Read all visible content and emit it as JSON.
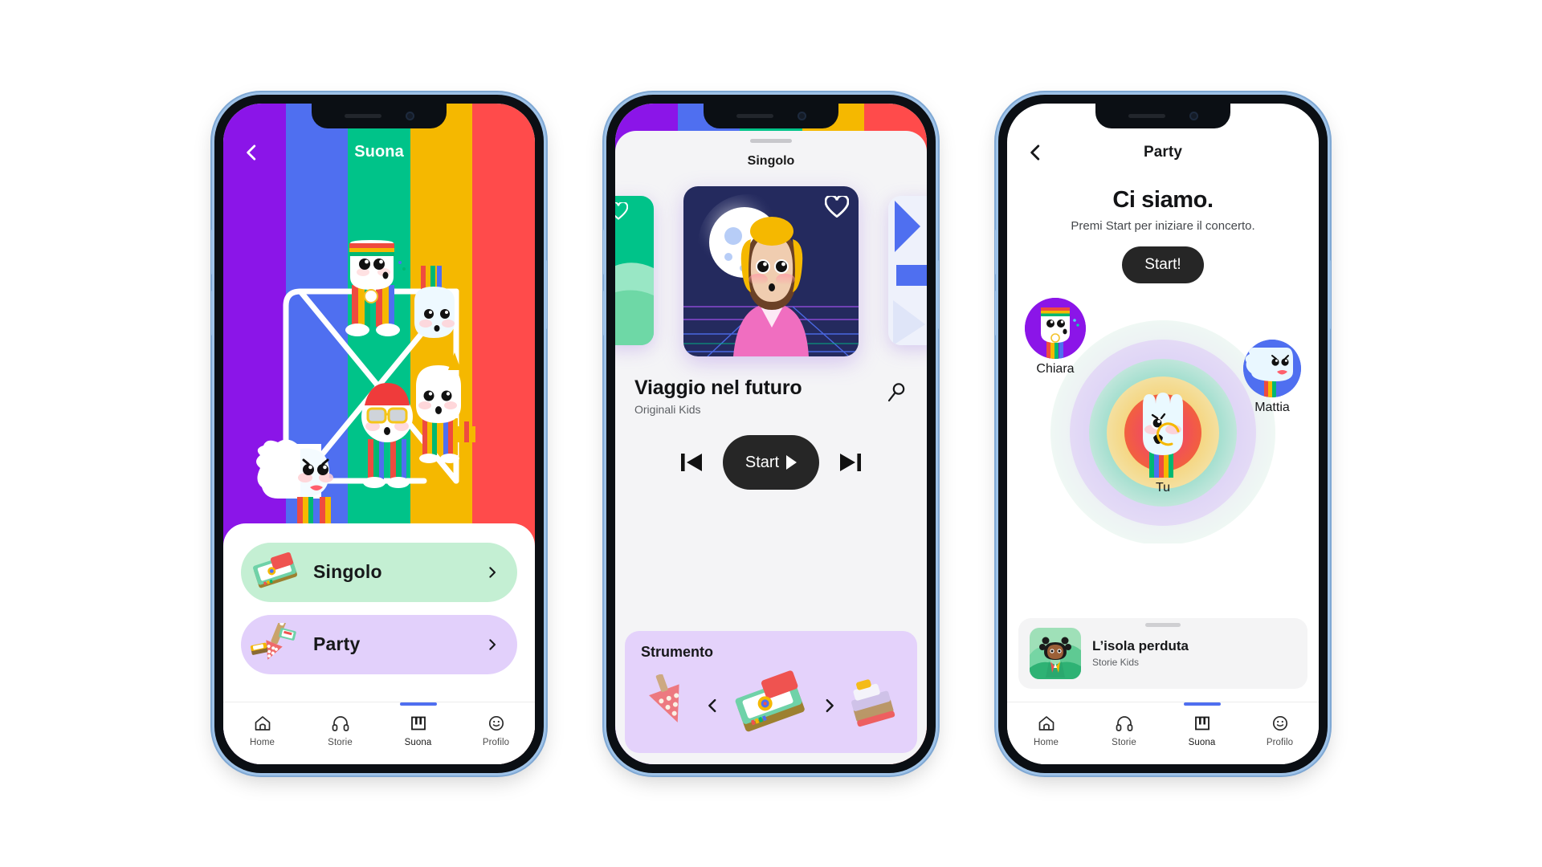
{
  "palette": {
    "purple": "#8B15E8",
    "blue": "#4F6FF0",
    "green": "#00C389",
    "yellow": "#F5B800",
    "red": "#FF4B4B",
    "accent_tab": "#4f6ff0",
    "dark_button": "#262626",
    "mint_row": "#C4EFD3",
    "lavender_row": "#E2D0FB",
    "instrument_panel": "#E4D2FB"
  },
  "tabbar": {
    "items": [
      {
        "label": "Home",
        "icon": "home-icon",
        "active": false
      },
      {
        "label": "Storie",
        "icon": "headphones-icon",
        "active": false
      },
      {
        "label": "Suona",
        "icon": "piano-keys-icon",
        "active": true
      },
      {
        "label": "Profilo",
        "icon": "smiley-face-icon",
        "active": false
      }
    ]
  },
  "phone1": {
    "header": {
      "title": "Suona",
      "back_icon": "chevron-left-icon"
    },
    "menu": [
      {
        "label": "Singolo",
        "icon": "keyboard-instrument-icon",
        "chevron": "chevron-right-icon"
      },
      {
        "label": "Party",
        "icon": "instruments-group-icon",
        "chevron": "chevron-right-icon"
      }
    ]
  },
  "phone2": {
    "header": {
      "title": "Singolo"
    },
    "album": {
      "favorite_icon": "heart-outline-icon"
    },
    "song": {
      "title": "Viaggio nel futuro",
      "artist": "Originali Kids"
    },
    "search_icon": "search-icon",
    "controls": {
      "previous_icon": "skip-previous-icon",
      "start_label": "Start",
      "play_icon": "play-triangle-icon",
      "next_icon": "skip-next-icon"
    },
    "instrument": {
      "title": "Strumento",
      "prev_icon": "chevron-left-icon",
      "next_icon": "chevron-right-icon"
    }
  },
  "phone3": {
    "header": {
      "title": "Party",
      "back_icon": "chevron-left-icon"
    },
    "hero": {
      "heading": "Ci siamo.",
      "subtitle": "Premi Start per iniziare il concerto.",
      "button_label": "Start!"
    },
    "peers": [
      {
        "name": "Chiara",
        "ring_color": "#8B15E8"
      },
      {
        "name": "Mattia",
        "ring_color": "#4F6FF0"
      },
      {
        "name": "Tu",
        "ring_color": "#FF4B4B"
      }
    ],
    "now_card": {
      "title": "L’isola perduta",
      "subtitle": "Storie Kids"
    }
  }
}
